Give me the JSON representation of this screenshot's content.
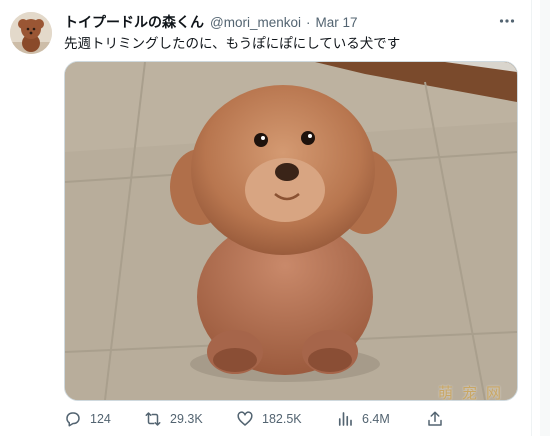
{
  "tweet": {
    "display_name": "トイプードルの森くん",
    "handle": "@mori_menkoi",
    "separator": "·",
    "date": "Mar 17",
    "text": "先週トリミングしたのに、もうぽにぽにしている犬です"
  },
  "media": {
    "description_icon": "photo-toy-poodle"
  },
  "watermark": "萌宠网",
  "actions": {
    "replies": "124",
    "retweets": "29.3K",
    "likes": "182.5K",
    "views": "6.4M"
  },
  "icons": {
    "more": "more-horizontal-icon",
    "reply": "reply-icon",
    "retweet": "retweet-icon",
    "like": "heart-icon",
    "views": "views-chart-icon",
    "share": "share-icon"
  },
  "colors": {
    "text_primary": "#0f1419",
    "text_secondary": "#536471",
    "border": "#cfd9de"
  }
}
